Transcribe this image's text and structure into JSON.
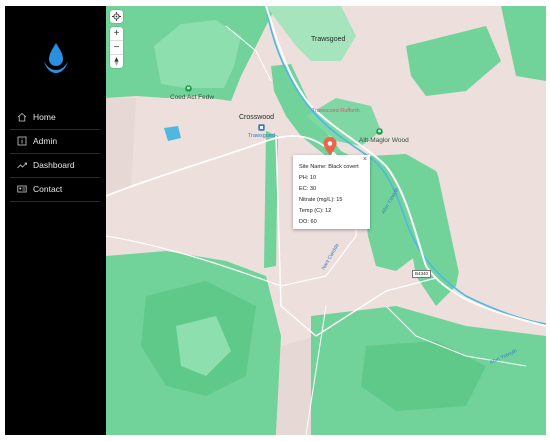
{
  "sidebar": {
    "logo_icon": "water-drop-logo",
    "items": [
      {
        "label": "Home",
        "icon": "home-icon"
      },
      {
        "label": "Admin",
        "icon": "info-icon"
      },
      {
        "label": "Dashboard",
        "icon": "trend-icon"
      },
      {
        "label": "Contact",
        "icon": "contact-card-icon"
      }
    ]
  },
  "map": {
    "controls": {
      "locate_icon": "locate-icon",
      "zoom_in": "+",
      "zoom_out": "−",
      "compass_icon": "compass-icon"
    },
    "labels": {
      "trawsgoed": "Trawsgoed",
      "coed_act_fedw": "Coed Act Fedw",
      "crosswood": "Crosswood",
      "trawsgoed_small": "Trawsgoed",
      "trawscoed_pink": "Trawscoed Rufforth",
      "allt_wood": "Allt-Maglor Wood",
      "road_right": "Afon Ystwyth",
      "road_mid": "Nant Cwrdda",
      "road_bottom": "Afon Ystwyth",
      "road_badge": "B4340"
    },
    "popup": {
      "site_name": "Site Name: Black covert",
      "ph": "PH: 10",
      "ec": "EC: 30",
      "nitrate": "Nitrate (mg/L): 15",
      "temp": "Temp (C): 12",
      "do": "DO: 60",
      "close": "×"
    },
    "colors": {
      "forest": "#72d39a",
      "land": "#ecdfdc",
      "water": "#4fb8e0",
      "marker": "#e8664a"
    }
  }
}
